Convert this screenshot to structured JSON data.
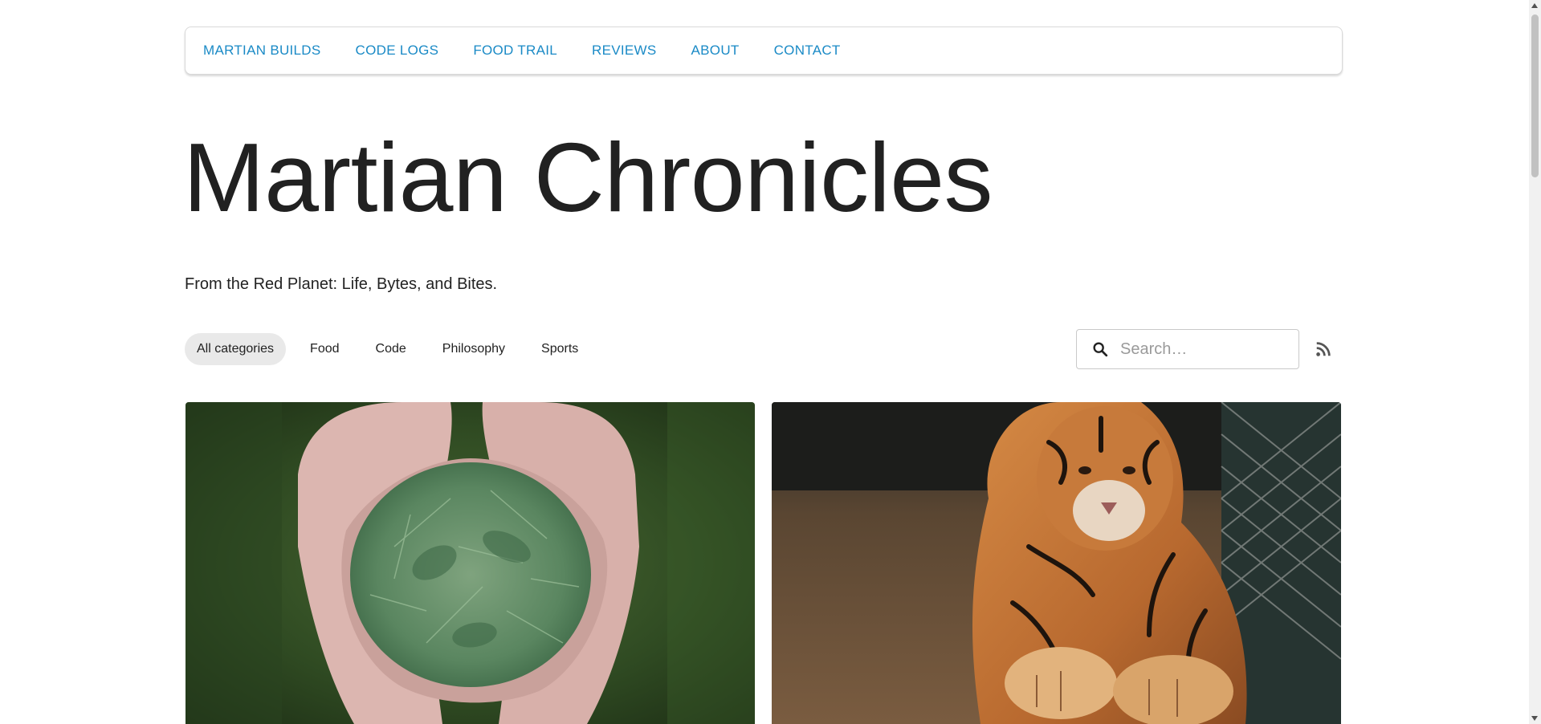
{
  "nav": {
    "items": [
      {
        "label": "MARTIAN BUILDS"
      },
      {
        "label": "CODE LOGS"
      },
      {
        "label": "FOOD TRAIL"
      },
      {
        "label": "REVIEWS"
      },
      {
        "label": "ABOUT"
      },
      {
        "label": "CONTACT"
      }
    ]
  },
  "header": {
    "title": "Martian Chronicles",
    "tagline": "From the Red Planet: Life, Bytes, and Bites."
  },
  "categories": {
    "items": [
      {
        "label": "All categories",
        "active": true
      },
      {
        "label": "Food"
      },
      {
        "label": "Code"
      },
      {
        "label": "Philosophy"
      },
      {
        "label": "Sports"
      }
    ]
  },
  "search": {
    "placeholder": "Search…",
    "value": "",
    "icon": "search-icon"
  },
  "rss": {
    "icon": "rss-icon"
  },
  "colors": {
    "accent": "#1a8ac6",
    "title": "#212121",
    "pill_active_bg": "#e9e9e9"
  },
  "posts": [
    {
      "image": "hands-holding-pine-needles"
    },
    {
      "image": "tiger-lying-near-fence"
    }
  ]
}
